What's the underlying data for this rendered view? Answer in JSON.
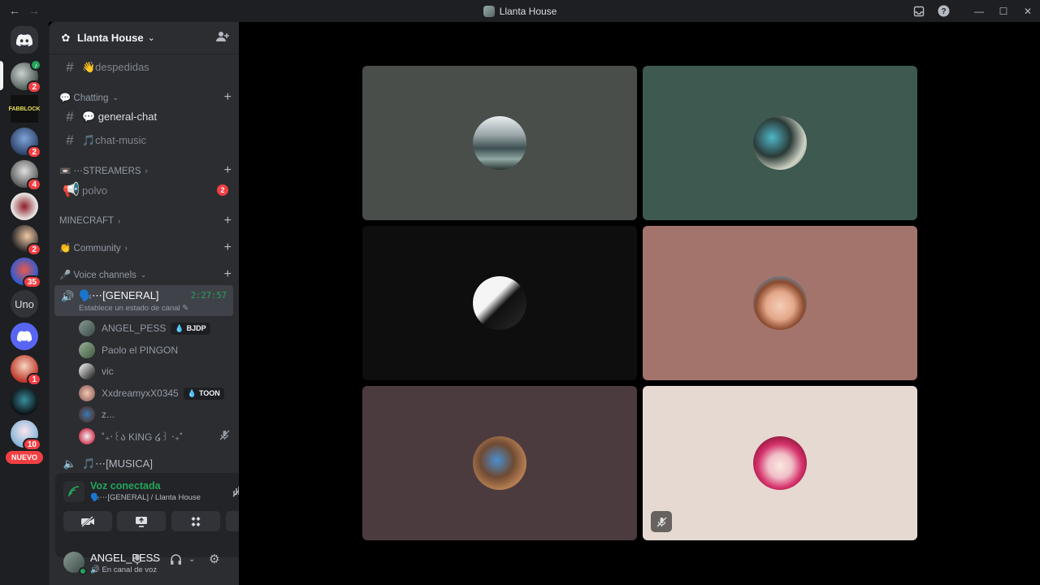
{
  "titlebar": {
    "title": "Llanta House",
    "back_icon": "arrow-left-icon",
    "forward_icon": "arrow-right-icon"
  },
  "rail": {
    "servers": [
      {
        "badge": "2"
      },
      {
        "badge": ""
      },
      {
        "badge": "2"
      },
      {
        "badge": "4"
      },
      {
        "badge": ""
      },
      {
        "badge": "2"
      },
      {
        "badge": "35"
      },
      {
        "badge": "1"
      },
      {
        "badge": ""
      },
      {
        "badge": "10"
      }
    ],
    "uno_label": "Uno",
    "nuevo_label": "NUEVO"
  },
  "server": {
    "name": "Llanta House"
  },
  "channels": {
    "despedidas": "👋despedidas",
    "cat_chatting": "💬 Chatting",
    "general_chat": "💬 general-chat",
    "chat_music": "🎵chat-music",
    "cat_streamers": "📼 ⋯STREAMERS",
    "polvo": "polvo",
    "polvo_badge": "2",
    "cat_minecraft": "MINECRAFT",
    "cat_community": "👏 Community",
    "cat_voice": "🎤 Voice channels",
    "voice_general": "🗣️⋯[GENERAL]",
    "voice_timer": "2:27:57",
    "voice_status": "Establece un estado de canal",
    "voice_musica": "🎵⋯[MUSICA]"
  },
  "voice_users": [
    {
      "name": "ANGEL_PESS",
      "tag": "BJDP"
    },
    {
      "name": "Paolo el PINGON",
      "tag": ""
    },
    {
      "name": "vic",
      "tag": ""
    },
    {
      "name": "XxdreamyxX0345",
      "tag": "TOON"
    },
    {
      "name": "z...",
      "tag": ""
    },
    {
      "name": "˚₊‧꒰ა KING ໒꒱ ‧₊˚",
      "tag": ""
    }
  ],
  "voice_panel": {
    "title": "Voz conectada",
    "subtitle": "🗣️⋯[GENERAL] / Llanta House"
  },
  "user_panel": {
    "name": "ANGEL_PESS",
    "status": "🔊 En canal de voz"
  },
  "colors": {
    "tile1": "#4a4e4a",
    "tile2": "#3e5a50",
    "tile3": "#0e0e0e",
    "tile4": "#a2746b",
    "tile5": "#4c3b3e",
    "tile6": "#e5d9d2",
    "accent_green": "#23a55a",
    "badge_red": "#f23f43"
  }
}
